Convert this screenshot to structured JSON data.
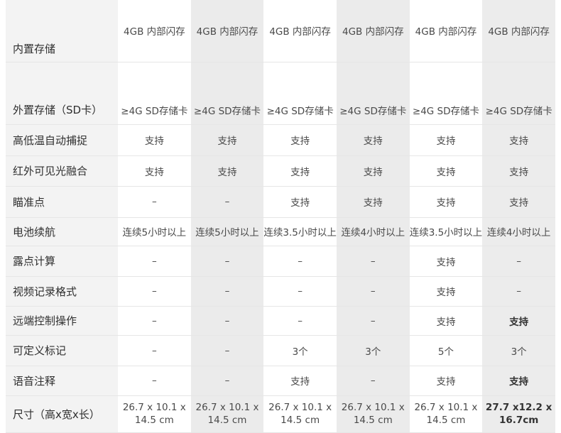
{
  "table": {
    "rows": [
      {
        "key": "storage_internal",
        "label": "内置存储",
        "values": [
          "4GB 内部闪存",
          "4GB 内部闪存",
          "4GB 内部闪存",
          "4GB 内部闪存",
          "4GB 内部闪存",
          "4GB 内部闪存"
        ]
      },
      {
        "key": "storage_external",
        "label": "外置存储（SD卡）",
        "values": [
          "≥4G SD存储卡",
          "≥4G SD存储卡",
          "≥4G SD存储卡",
          "≥4G SD存储卡",
          "≥4G SD存储卡",
          "≥4G SD存储卡"
        ]
      },
      {
        "key": "auto_capture",
        "label": "高低温自动捕捉",
        "values": [
          "支持",
          "支持",
          "支持",
          "支持",
          "支持",
          "支持"
        ]
      },
      {
        "key": "ir_fusion",
        "label": " 红外可见光融合",
        "values": [
          "支持",
          "支持",
          "支持",
          "支持",
          "支持",
          "支持"
        ]
      },
      {
        "key": "aim_point",
        "label": "瞄准点",
        "values": [
          "–",
          "–",
          "支持",
          "支持",
          "支持",
          "支持"
        ]
      },
      {
        "key": "battery",
        "label": "电池续航",
        "values": [
          "连续5小时以上",
          "连续5小时以上",
          "连续3.5小时以上",
          "连续4小时以上",
          "连续3.5小时以上",
          "连续4小时以上"
        ]
      },
      {
        "key": "dew_point",
        "label": "露点计算",
        "values": [
          "–",
          "–",
          "–",
          "–",
          "支持",
          "–"
        ]
      },
      {
        "key": "video_format",
        "label": "视频记录格式",
        "values": [
          "–",
          "–",
          "–",
          "–",
          "支持",
          "–"
        ]
      },
      {
        "key": "remote",
        "label": "远端控制操作",
        "values": [
          "–",
          "–",
          "–",
          "–",
          "支持",
          "支持"
        ]
      },
      {
        "key": "markers",
        "label": "可定义标记",
        "values": [
          "–",
          "–",
          "3个",
          "3个",
          "5个",
          "3个"
        ]
      },
      {
        "key": "voice",
        "label": "语音注释",
        "values": [
          "–",
          "–",
          "支持",
          "–",
          "支持",
          "支持"
        ]
      },
      {
        "key": "size",
        "label": "尺寸（高x宽x长）",
        "values": [
          "26.7 x 10.1 x 14.5 cm",
          "26.7 x 10.1 x 14.5 cm",
          "26.7 x 10.1 x 14.5 cm",
          "26.7 x 10.1 x 14.5 cm",
          "26.7 x 10.1 x 14.5 cm",
          "27.7 x12.2 x 16.7cm"
        ]
      }
    ]
  }
}
